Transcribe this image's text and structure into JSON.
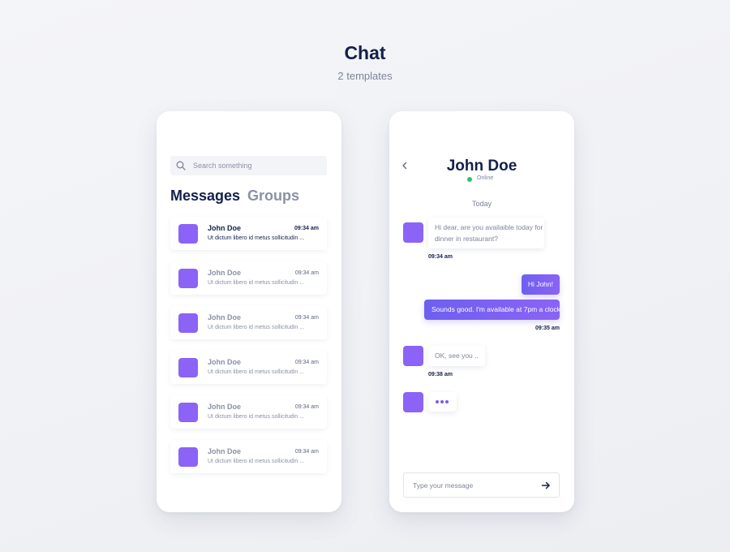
{
  "header": {
    "title": "Chat",
    "subtitle": "2 templates"
  },
  "colors": {
    "accent": "#8b63f6",
    "accent_gradient_start": "#6e5ff0",
    "title_navy": "#14204a",
    "muted": "#8a91a6",
    "online": "#2fc16b"
  },
  "messages_screen": {
    "search": {
      "placeholder": "Search something",
      "icon": "search-icon"
    },
    "tabs": [
      {
        "label": "Messages",
        "active": true
      },
      {
        "label": "Groups",
        "active": false
      }
    ],
    "conversations": [
      {
        "name": "John Doe",
        "time": "09:34 am",
        "preview": "Ut dictum libero id metus sollicitudin ...",
        "unread": true
      },
      {
        "name": "John Doe",
        "time": "09:34 am",
        "preview": "Ut dictum libero id metus sollicitudin ...",
        "unread": false
      },
      {
        "name": "John Doe",
        "time": "09:34 am",
        "preview": "Ut dictum libero id metus sollicitudin ...",
        "unread": false
      },
      {
        "name": "John Doe",
        "time": "09:34 am",
        "preview": "Ut dictum libero id metus sollicitudin ...",
        "unread": false
      },
      {
        "name": "John Doe",
        "time": "09:34 am",
        "preview": "Ut dictum libero id metus sollicitudin ...",
        "unread": false
      },
      {
        "name": "John Doe",
        "time": "09:34 am",
        "preview": "Ut dictum libero id metus sollicitudin ...",
        "unread": false
      }
    ]
  },
  "chat_screen": {
    "back_icon": "chevron-left-icon",
    "contact_name": "John Doe",
    "status": "Online",
    "day_label": "Today",
    "messages": [
      {
        "direction": "incoming",
        "lines": [
          "Hi dear, are you availaible today for",
          "dinner in restaurant?"
        ],
        "time": "09:34 am"
      },
      {
        "direction": "outgoing",
        "text": "Hi John!"
      },
      {
        "direction": "outgoing",
        "text": "Sounds good. I'm available at 7pm a clock",
        "time": "09:35 am"
      },
      {
        "direction": "incoming",
        "text": "OK, see you ..",
        "time": "09:38 am"
      },
      {
        "direction": "incoming",
        "typing": true
      }
    ],
    "composer": {
      "placeholder": "Type your message",
      "send_icon": "arrow-right-icon"
    }
  }
}
